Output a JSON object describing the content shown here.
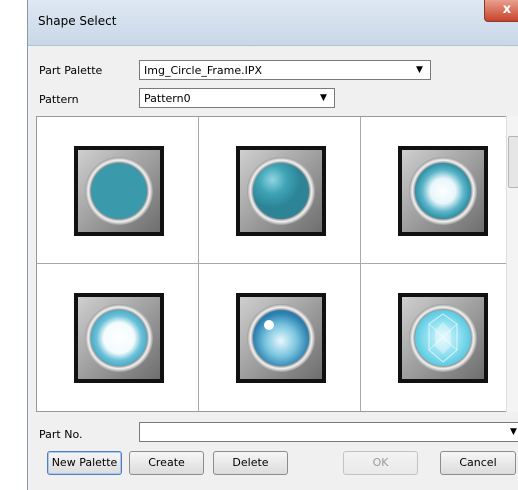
{
  "window": {
    "title": "Shape Select",
    "close_glyph": "x"
  },
  "form": {
    "part_palette_label": "Part Palette",
    "part_palette_value": "Img_Circle_Frame.IPX",
    "pattern_label": "Pattern",
    "pattern_value": "Pattern0",
    "part_no_label": "Part No.",
    "part_no_value": "",
    "dropdown_arrow": "▼"
  },
  "shapes": [
    {
      "name": "teal-flat-lamp",
      "fill": "#3a9aab"
    },
    {
      "name": "teal-highlight-lamp",
      "fill": "#3fa3b6"
    },
    {
      "name": "teal-white-glow-lamp",
      "fill": "#2e8fa5"
    },
    {
      "name": "white-center-lamp",
      "fill": "#4aaecb"
    },
    {
      "name": "glossy-blue-lamp",
      "fill": "#2a7fb0"
    },
    {
      "name": "crystal-cyan-lamp",
      "fill": "#5cc9e0"
    }
  ],
  "buttons": {
    "new_palette": "New Palette",
    "create": "Create",
    "delete": "Delete",
    "ok": "OK",
    "cancel": "Cancel"
  }
}
